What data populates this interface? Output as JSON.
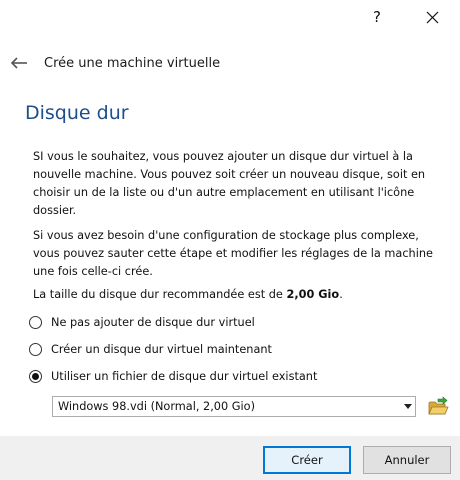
{
  "titlebar": {
    "help_label": "?",
    "close_label": "✕"
  },
  "wizard": {
    "title": "Crée une machine virtuelle"
  },
  "page": {
    "title": "Disque dur",
    "paragraph1": "SI vous le souhaitez, vous pouvez ajouter un disque dur virtuel à la nouvelle machine. Vous pouvez soit créer un nouveau disque, soit en choisir un de la liste ou d'un autre emplacement en utilisant l'icône dossier.",
    "paragraph2": "Si vous avez besoin d'une configuration de stockage plus complexe, vous pouvez sauter cette étape et modifier les réglages de la machine une fois celle-ci crée.",
    "recommended_prefix": "La taille du disque dur recommandée est de ",
    "recommended_size": "2,00 Gio",
    "recommended_suffix": "."
  },
  "options": {
    "no_disk": "Ne pas ajouter de disque dur virtuel",
    "create_disk": "Créer un disque dur virtuel maintenant",
    "use_existing": "Utiliser un fichier de disque dur virtuel existant",
    "selected": "use_existing"
  },
  "disk_select": {
    "value": "Windows 98.vdi (Normal, 2,00 Gio)"
  },
  "buttons": {
    "create": "Créer",
    "cancel": "Annuler"
  },
  "colors": {
    "title_blue": "#1e4f8a",
    "default_button_border": "#0078d7"
  },
  "icons": {
    "back": "arrow-left-icon",
    "folder": "folder-open-icon",
    "dropdown": "chevron-down-icon"
  }
}
